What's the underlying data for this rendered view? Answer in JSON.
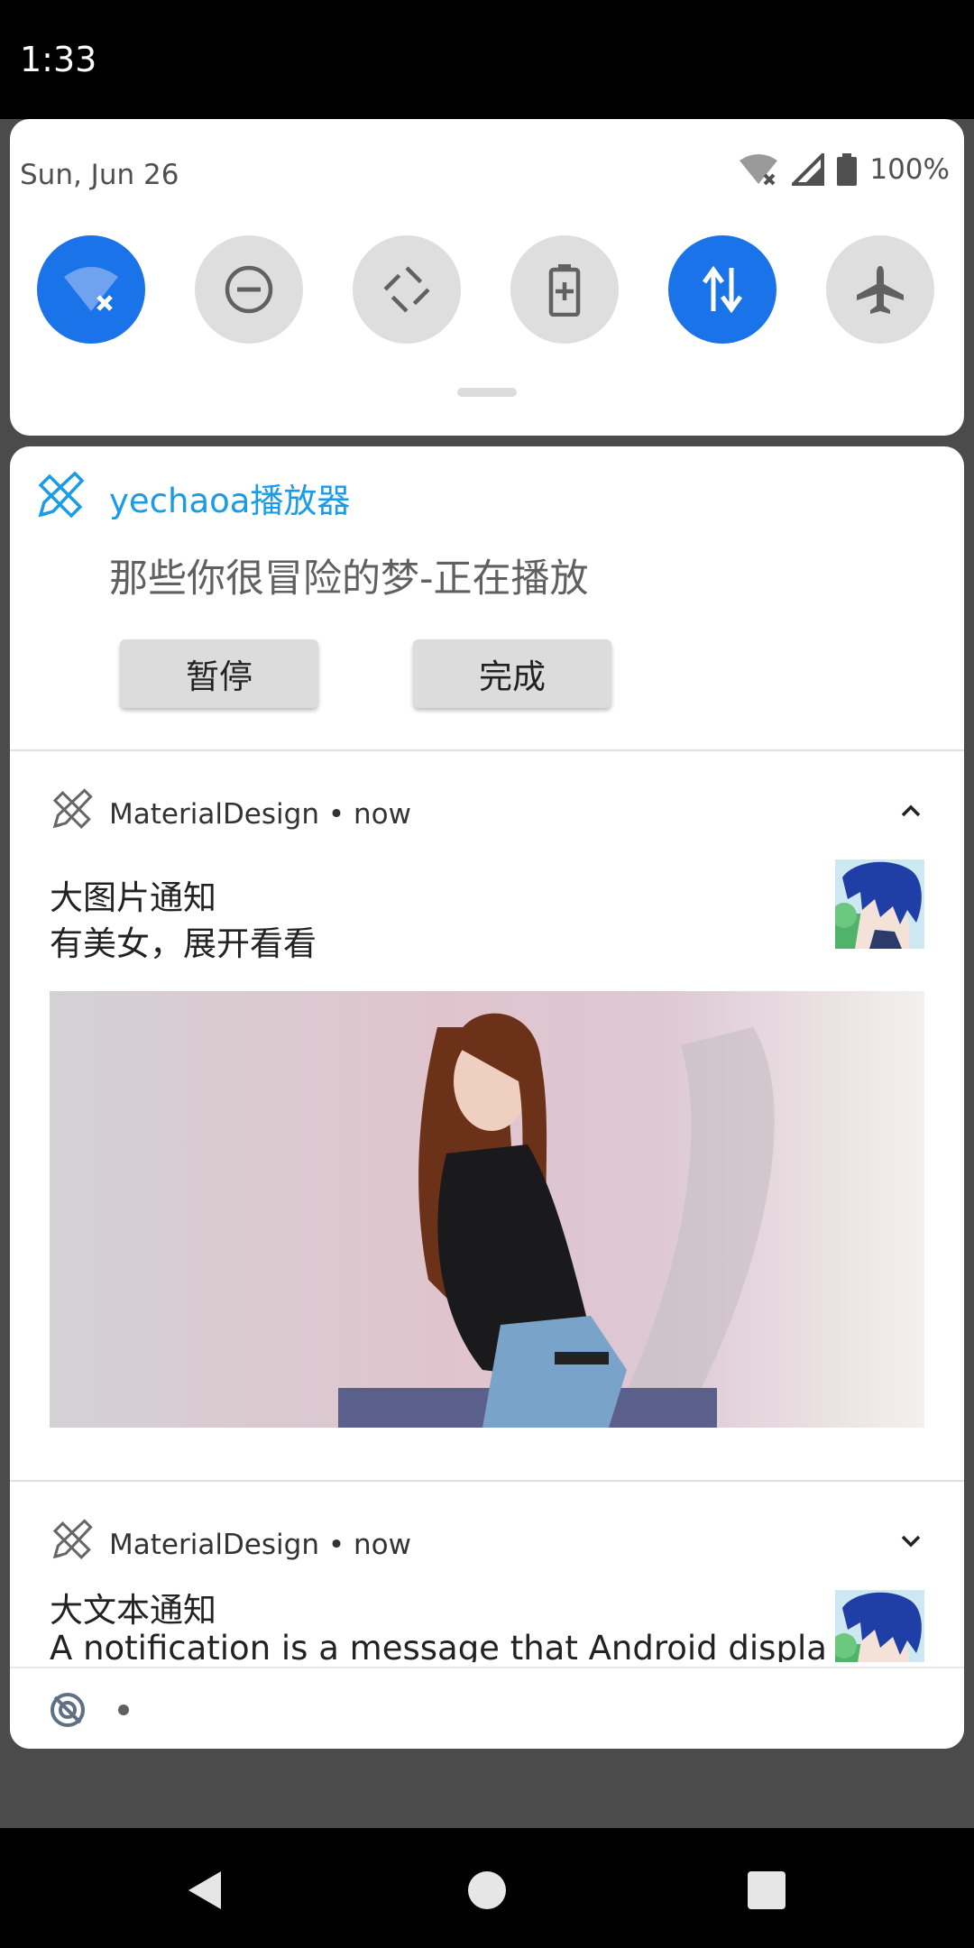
{
  "status_bar": {
    "time": "1:33"
  },
  "quick_settings": {
    "date": "Sun, Jun 26",
    "battery_percent": "100%",
    "tiles": [
      {
        "icon": "wifi-off-icon",
        "active": true
      },
      {
        "icon": "do-not-disturb-icon",
        "active": false
      },
      {
        "icon": "auto-rotate-icon",
        "active": false
      },
      {
        "icon": "battery-saver-icon",
        "active": false
      },
      {
        "icon": "mobile-data-icon",
        "active": true
      },
      {
        "icon": "airplane-mode-icon",
        "active": false
      }
    ]
  },
  "notifications": {
    "player": {
      "app_name": "yechaoa播放器",
      "text": "那些你很冒险的梦-正在播放",
      "actions": [
        "暂停",
        "完成"
      ]
    },
    "big_picture": {
      "app_name": "MaterialDesign",
      "separator": "•",
      "time": "now",
      "title": "大图片通知",
      "text": "有美女，展开看看",
      "expanded": true
    },
    "big_text": {
      "app_name": "MaterialDesign",
      "separator": "•",
      "time": "now",
      "title": "大文本通知",
      "text": "A notification is a message that Android displa",
      "expanded": false
    }
  },
  "footer": {
    "dot": "•"
  },
  "colors": {
    "accent": "#1a73e8",
    "app_name_blue": "#1a9be8",
    "tile_off": "#dedede"
  }
}
